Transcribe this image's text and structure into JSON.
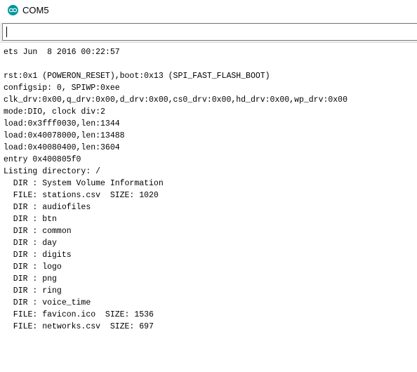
{
  "window": {
    "title": "COM5",
    "icon": "arduino-icon"
  },
  "send_input": {
    "value": ""
  },
  "console": {
    "lines": [
      "ets Jun  8 2016 00:22:57",
      "",
      "rst:0x1 (POWERON_RESET),boot:0x13 (SPI_FAST_FLASH_BOOT)",
      "configsip: 0, SPIWP:0xee",
      "clk_drv:0x00,q_drv:0x00,d_drv:0x00,cs0_drv:0x00,hd_drv:0x00,wp_drv:0x00",
      "mode:DIO, clock div:2",
      "load:0x3fff0030,len:1344",
      "load:0x40078000,len:13488",
      "load:0x40080400,len:3604",
      "entry 0x400805f0",
      "Listing directory: /",
      "  DIR : System Volume Information",
      "  FILE: stations.csv  SIZE: 1020",
      "  DIR : audiofiles",
      "  DIR : btn",
      "  DIR : common",
      "  DIR : day",
      "  DIR : digits",
      "  DIR : logo",
      "  DIR : png",
      "  DIR : ring",
      "  DIR : voice_time",
      "  FILE: favicon.ico  SIZE: 1536",
      "  FILE: networks.csv  SIZE: 697"
    ]
  },
  "colors": {
    "icon_teal": "#00979c",
    "input_border": "#7a7a7a",
    "strip_background": "#f0f0f0"
  }
}
